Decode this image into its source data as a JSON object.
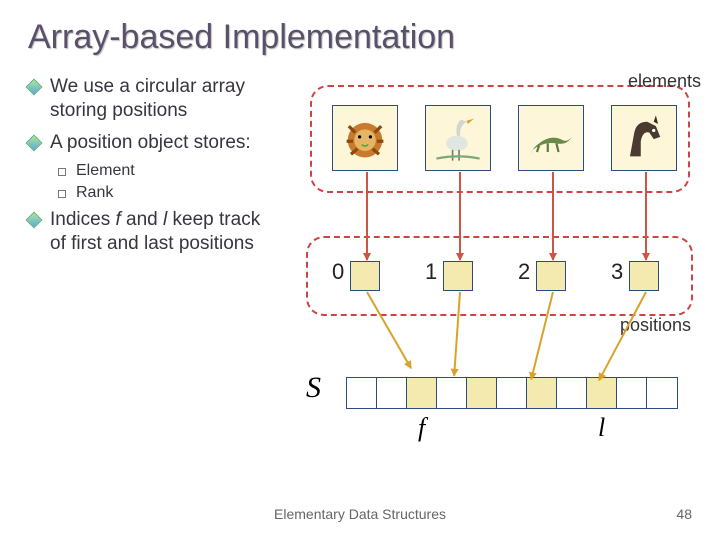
{
  "title": "Array-based Implementation",
  "bullets": {
    "a": "We use a circular array storing positions",
    "b": "A position object stores:",
    "b_sub": {
      "e": "Element",
      "r": "Rank"
    },
    "c_pre": "Indices ",
    "c_f": "f",
    "c_mid": " and ",
    "c_l": "l",
    "c_post": " keep track of first and last positions"
  },
  "labels": {
    "elements": "elements",
    "positions": "positions",
    "S": "S",
    "f": "f",
    "l": "l"
  },
  "position_indices": [
    "0",
    "1",
    "2",
    "3"
  ],
  "array": {
    "cells": 11,
    "filled_indices": [
      2,
      4,
      6,
      8
    ]
  },
  "icons": [
    "lion-icon",
    "crane-icon",
    "lizard-icon",
    "horse-icon"
  ],
  "footer": "Elementary Data Structures",
  "page": "48"
}
